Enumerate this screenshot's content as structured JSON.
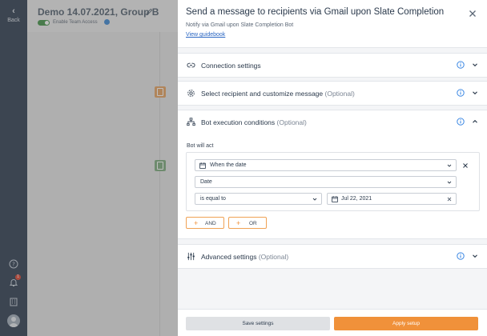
{
  "rail": {
    "back_label": "Back",
    "notification_count": "1"
  },
  "flow": {
    "title": "Demo 14.07.2021, Group B",
    "team_access_label": "Enable Team Access"
  },
  "panel": {
    "title": "Send a message to recipients via Gmail upon Slate Completion",
    "subtitle": "Notify via Gmail upon Slate Completion Bot",
    "guide_link": "View guidebook",
    "sections": {
      "connection": {
        "title": "Connection settings"
      },
      "recipient": {
        "title": "Select recipient and customize message",
        "optional": "(Optional)"
      },
      "conditions": {
        "title": "Bot execution conditions",
        "optional": "(Optional)",
        "bot_will_act": "Bot will act",
        "when_field": "When the date",
        "date_field": "Date",
        "operator_field": "is equal to",
        "value_field": "Jul 22, 2021",
        "and_label": "AND",
        "or_label": "OR"
      },
      "advanced": {
        "title": "Advanced settings",
        "optional": "(Optional)"
      }
    },
    "footer": {
      "save_label": "Save settings",
      "apply_label": "Apply setup"
    }
  },
  "colors": {
    "rail": "#3d4a5c",
    "accent_orange": "#f0913a",
    "info_blue": "#2a7de1",
    "toggle_green": "#4f9a53"
  }
}
